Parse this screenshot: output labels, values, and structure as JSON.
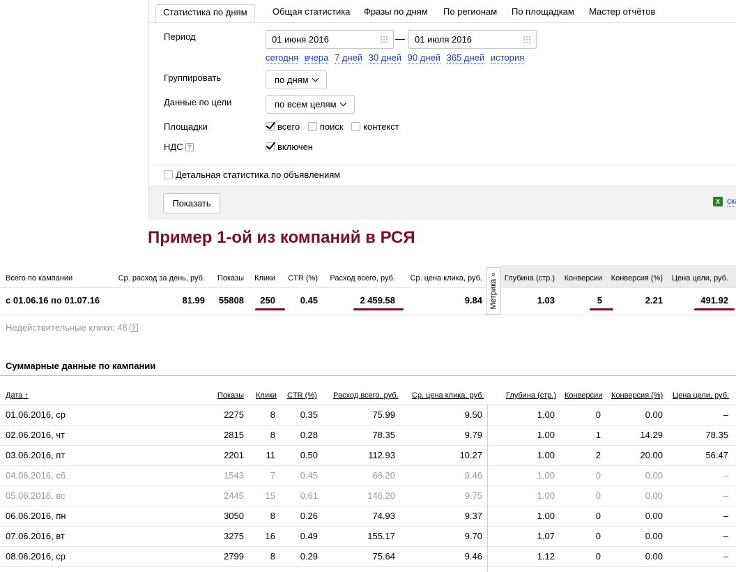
{
  "tabs": [
    "Статистика по дням",
    "Общая статистика",
    "Фразы по дням",
    "По регионам",
    "По площадкам",
    "Мастер отчётов"
  ],
  "filters": {
    "period_label": "Период",
    "date_from": "01 июня 2016",
    "date_sep": "—",
    "date_to": "01 июля 2016",
    "quick_ranges": [
      "сегодня",
      "вчера",
      "7 дней",
      "30 дней",
      "90 дней",
      "365 дней",
      "история"
    ],
    "group_label": "Группировать",
    "group_value": "по дням",
    "goal_label": "Данные по цели",
    "goal_value": "по всем целям",
    "platforms_label": "Площадки",
    "platform_all": "всего",
    "platform_search": "поиск",
    "platform_context": "контекст",
    "vat_label": "НДС",
    "vat_help": "?",
    "vat_value": "включен",
    "detail_label": "Детальная статистика по объявлениям",
    "show_button": "Показать",
    "excel_link": "скачать"
  },
  "headline": "Пример 1-ой из компаний в РСЯ",
  "summary": {
    "headers": {
      "total": "Всего по кампании",
      "avg_spend": "Ср. расход за день, руб.",
      "impressions": "Показы",
      "clicks": "Клики",
      "ctr": "CTR (%)",
      "spend": "Расход всего, руб.",
      "cpc": "Ср. цена клика, руб.",
      "depth": "Глубина (стр.)",
      "conversions": "Конверсии",
      "conv_rate": "Конверсия (%)",
      "goal_price": "Цена цели, руб."
    },
    "metrika_tab": "Метрика »",
    "row": {
      "period": "с 01.06.16 по 01.07.16",
      "avg_spend": "81.99",
      "impressions": "55808",
      "clicks": "250",
      "ctr": "0.45",
      "spend": "2 459.58",
      "cpc": "9.84",
      "depth": "1.03",
      "conversions": "5",
      "conv_rate": "2.21",
      "goal_price": "491.92"
    },
    "invalid_clicks": "Недействительные клики: 48",
    "invalid_help": "?"
  },
  "detail": {
    "title": "Суммарные данные по кампании",
    "headers": {
      "date": "Дата ↑",
      "impressions": "Показы",
      "clicks": "Клики",
      "ctr": "CTR (%)",
      "spend": "Расход всего, руб.",
      "cpc": "Ср. цена клика, руб.",
      "depth": "Глубина (стр.)",
      "conversions": "Конверсии",
      "conv_rate": "Конверсия (%)",
      "goal_price": "Цена цели, руб."
    },
    "rows": [
      {
        "date": "01.06.2016, ср",
        "impressions": "2275",
        "clicks": "8",
        "ctr": "0.35",
        "spend": "75.99",
        "cpc": "9.50",
        "depth": "1.00",
        "conversions": "0",
        "conv_rate": "0.00",
        "goal_price": "–",
        "weekend": false
      },
      {
        "date": "02.06.2016, чт",
        "impressions": "2815",
        "clicks": "8",
        "ctr": "0.28",
        "spend": "78.35",
        "cpc": "9.79",
        "depth": "1.00",
        "conversions": "1",
        "conv_rate": "14.29",
        "goal_price": "78.35",
        "weekend": false
      },
      {
        "date": "03.06.2016, пт",
        "impressions": "2201",
        "clicks": "11",
        "ctr": "0.50",
        "spend": "112.93",
        "cpc": "10.27",
        "depth": "1.00",
        "conversions": "2",
        "conv_rate": "20.00",
        "goal_price": "56.47",
        "weekend": false
      },
      {
        "date": "04.06.2016, сб",
        "impressions": "1543",
        "clicks": "7",
        "ctr": "0.45",
        "spend": "66.20",
        "cpc": "9.46",
        "depth": "1.00",
        "conversions": "0",
        "conv_rate": "0.00",
        "goal_price": "–",
        "weekend": true
      },
      {
        "date": "05.06.2016, вс",
        "impressions": "2445",
        "clicks": "15",
        "ctr": "0.61",
        "spend": "146.20",
        "cpc": "9.75",
        "depth": "1.00",
        "conversions": "0",
        "conv_rate": "0.00",
        "goal_price": "–",
        "weekend": true
      },
      {
        "date": "06.06.2016, пн",
        "impressions": "3050",
        "clicks": "8",
        "ctr": "0.26",
        "spend": "74.93",
        "cpc": "9.37",
        "depth": "1.00",
        "conversions": "0",
        "conv_rate": "0.00",
        "goal_price": "–",
        "weekend": false
      },
      {
        "date": "07.06.2016, вт",
        "impressions": "3275",
        "clicks": "16",
        "ctr": "0.49",
        "spend": "155.17",
        "cpc": "9.70",
        "depth": "1.07",
        "conversions": "0",
        "conv_rate": "0.00",
        "goal_price": "–",
        "weekend": false
      },
      {
        "date": "08.06.2016, ср",
        "impressions": "2799",
        "clicks": "8",
        "ctr": "0.29",
        "spend": "75.64",
        "cpc": "9.46",
        "depth": "1.12",
        "conversions": "0",
        "conv_rate": "0.00",
        "goal_price": "–",
        "weekend": false
      }
    ]
  }
}
